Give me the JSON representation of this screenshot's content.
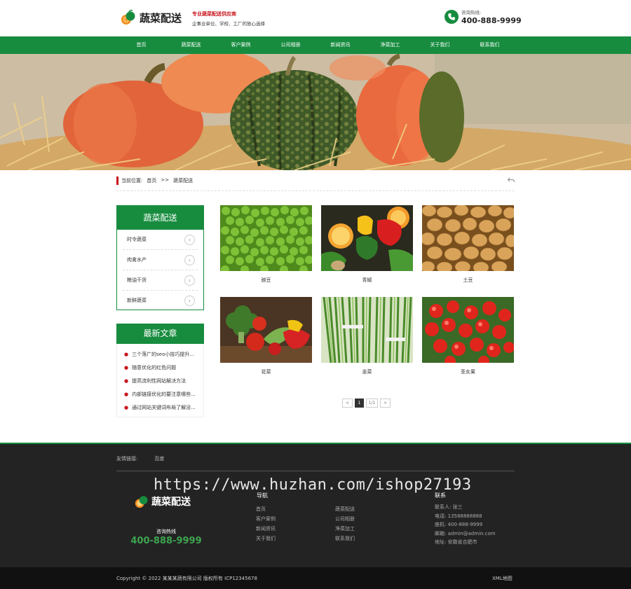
{
  "header": {
    "logo_text": "蔬菜配送",
    "tagline_main": "专业蔬菜配送供应商",
    "tagline_sub": "企事业单位、学校、工厂的放心选择",
    "hotline_label": "咨询热线:",
    "hotline_number": "400-888-9999"
  },
  "nav": {
    "items": [
      "首页",
      "蔬菜配送",
      "客户案例",
      "公司相册",
      "新闻资讯",
      "净菜加工",
      "关于我们",
      "联系我们"
    ]
  },
  "breadcrumb": {
    "label": "当前位置:",
    "home": "首页",
    "sep": ">>",
    "current": "蔬菜配送",
    "back_icon": "back-arrow-icon"
  },
  "sidebar": {
    "title": "蔬菜配送",
    "items": [
      "时令蔬菜",
      "肉禽水产",
      "粮油干货",
      "新鲜蔬菜"
    ]
  },
  "news": {
    "title": "最新文章",
    "items": [
      "三个落广的seo小技巧提升...",
      "随意优化的红色问题",
      "提高流利性网站解决方法",
      "内部链接优化的要注意哪些...",
      "通过网站关键词布局了解没..."
    ]
  },
  "products": [
    {
      "name": "豌豆"
    },
    {
      "name": "青椒"
    },
    {
      "name": "土豆"
    },
    {
      "name": "花菜"
    },
    {
      "name": "韭菜"
    },
    {
      "name": "圣女果"
    }
  ],
  "pagination": {
    "prev": "<",
    "current": "1",
    "total": "1/1",
    "next": ">"
  },
  "footer": {
    "friend_links_label": "友情链接:",
    "friend_link": "百度",
    "watermark": "https://www.huzhan.com/ishop27193",
    "logo_text": "蔬菜配送",
    "hotline_label": "咨询热线",
    "hotline_number": "400-888-9999",
    "nav_title": "导航",
    "nav_col1": [
      "首页",
      "客户案例",
      "新闻资讯",
      "关于我们"
    ],
    "nav_col2": [
      "蔬菜配送",
      "公司相册",
      "净菜加工",
      "联系我们"
    ],
    "contact_title": "联系",
    "contact": [
      "联系人: 张三",
      "电话: 13588888888",
      "座机: 400-888-9999",
      "邮箱: admin@admin.com",
      "地址: 安徽省合肥市"
    ],
    "copyright": "Copyright © 2022 某某某蔬有限公司 版权所有   ICP12345678",
    "sitemap": "XML地图"
  },
  "colors": {
    "brand_green": "#178c3f",
    "accent_red": "#c8161d",
    "footer_bg": "#232323"
  }
}
